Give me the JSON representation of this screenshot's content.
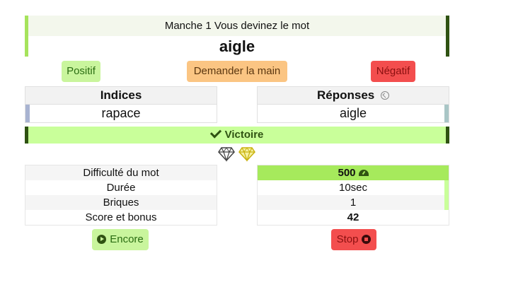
{
  "header": {
    "round_label": "Manche 1 Vous devinez le mot",
    "word": "aigle"
  },
  "actions": {
    "positive": "Positif",
    "ask_hand": "Demander la main",
    "negative": "Négatif"
  },
  "clues": {
    "title": "Indices",
    "value": "rapace"
  },
  "answers": {
    "title": "Réponses",
    "value": "aigle",
    "icon": "circle-arrow-left-icon"
  },
  "result": {
    "label": "Victoire",
    "icon": "check-icon",
    "color": "#c9ff9a"
  },
  "diamonds": {
    "icons": [
      "diamond-outline-icon",
      "diamond-gold-icon"
    ]
  },
  "stats": {
    "labels": [
      "Difficulté du mot",
      "Durée",
      "Briques",
      "Score et bonus"
    ],
    "values": [
      "500",
      "10sec",
      "1",
      "42"
    ],
    "difficulty_icon": "gauge-icon"
  },
  "footer": {
    "again": "Encore",
    "stop": "Stop"
  }
}
